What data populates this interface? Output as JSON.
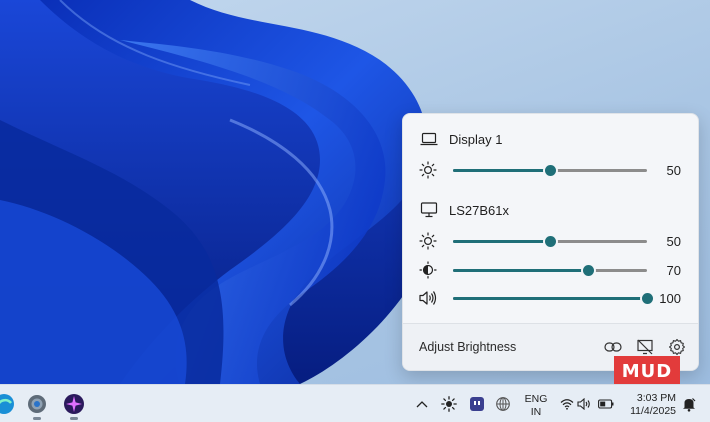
{
  "flyout": {
    "displays": [
      {
        "name": "Display 1",
        "icon": "laptop-icon",
        "controls": [
          {
            "type": "brightness",
            "icon": "sun-icon",
            "value": 50
          }
        ]
      },
      {
        "name": "LS27B61x",
        "icon": "monitor-icon",
        "controls": [
          {
            "type": "brightness",
            "icon": "sun-icon",
            "value": 50
          },
          {
            "type": "contrast",
            "icon": "contrast-icon",
            "value": 70
          },
          {
            "type": "volume",
            "icon": "speaker-icon",
            "value": 100
          }
        ]
      }
    ],
    "footer": {
      "label": "Adjust Brightness",
      "icons": [
        "link-icon",
        "presentation-icon",
        "gear-icon"
      ]
    },
    "accent": "#1f6f78"
  },
  "watermark": {
    "text": "MUD"
  },
  "taskbar": {
    "apps": [
      "edge-icon",
      "settings-app-icon",
      "star-app-icon"
    ],
    "tray": {
      "icons": [
        "chevron-up-icon",
        "brightness-tray-icon",
        "chat-app-icon",
        "globe-grid-icon"
      ],
      "language": {
        "line1": "ENG",
        "line2": "IN"
      },
      "status_icons": [
        "wifi-icon",
        "volume-icon",
        "battery-icon"
      ],
      "time": "3:03 PM",
      "date": "11/4/2025",
      "notification_icon": "bell-icon"
    }
  }
}
